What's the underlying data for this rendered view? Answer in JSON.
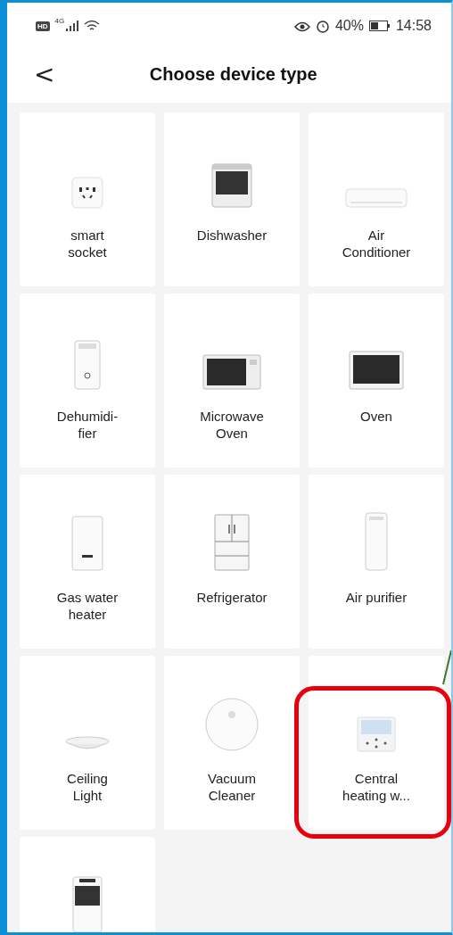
{
  "status_bar": {
    "hd": "HD",
    "network": "4G",
    "battery": "40%",
    "time": "14:58"
  },
  "header": {
    "back": "<",
    "title": "Choose device type"
  },
  "devices": [
    {
      "kind": "socket",
      "label": "smart\nsocket",
      "highlighted": false
    },
    {
      "kind": "dishwasher",
      "label": "Dishwasher",
      "highlighted": false
    },
    {
      "kind": "air-conditioner",
      "label": "Air\nConditioner",
      "highlighted": false
    },
    {
      "kind": "dehumidifier",
      "label": "Dehumidi-\nfier",
      "highlighted": false
    },
    {
      "kind": "microwave",
      "label": "Microwave\nOven",
      "highlighted": false
    },
    {
      "kind": "oven",
      "label": "Oven",
      "highlighted": false
    },
    {
      "kind": "water-heater",
      "label": "Gas water\nheater",
      "highlighted": false
    },
    {
      "kind": "refrigerator",
      "label": "Refrigerator",
      "highlighted": false
    },
    {
      "kind": "air-purifier",
      "label": "Air purifier",
      "highlighted": false
    },
    {
      "kind": "ceiling-light",
      "label": "Ceiling\nLight",
      "highlighted": false
    },
    {
      "kind": "vacuum",
      "label": "Vacuum\nCleaner",
      "highlighted": false
    },
    {
      "kind": "controller",
      "label": "Central\nheating w...",
      "highlighted": true
    },
    {
      "kind": "cabinet",
      "highlighted": false
    }
  ]
}
